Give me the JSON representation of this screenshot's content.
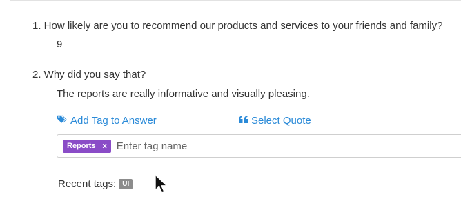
{
  "question1": {
    "title": "1. How likely are you to recommend our products and services to your friends and family?",
    "answer": "9"
  },
  "question2": {
    "title": "2. Why did you say that?",
    "answer": "The reports are really informative and visually pleasing.",
    "add_tag_label": "Add Tag to Answer",
    "select_quote_label": "Select Quote",
    "tag_input": {
      "placeholder": "Enter tag name",
      "value": ""
    },
    "applied_tags": [
      {
        "label": "Reports",
        "remove": "x",
        "color": "#8a4cc7"
      }
    ],
    "recent_tags_label": "Recent tags:",
    "recent_tags": [
      {
        "label": "UI",
        "color": "#8c8c8c"
      }
    ]
  },
  "icons": {
    "add_tag": "tags-icon",
    "select_quote": "quote-icon",
    "cursor": "mouse-pointer-icon"
  },
  "colors": {
    "link": "#2a8ad8",
    "text": "#333333"
  }
}
